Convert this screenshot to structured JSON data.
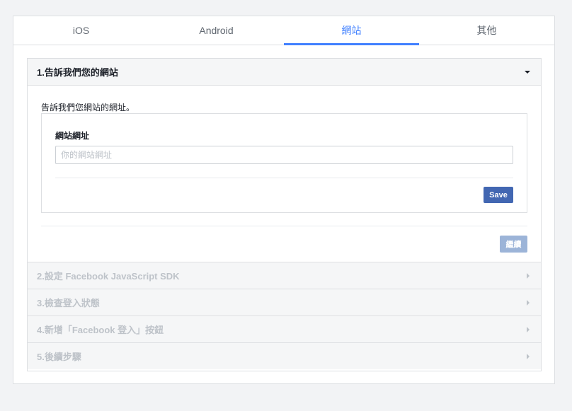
{
  "tabs": [
    {
      "label": "iOS",
      "active": false
    },
    {
      "label": "Android",
      "active": false
    },
    {
      "label": "網站",
      "active": true
    },
    {
      "label": "其他",
      "active": false
    }
  ],
  "step1": {
    "title": "1.告訴我們您的網站",
    "intro": "告訴我們您網站的網址。",
    "field_label": "網站網址",
    "placeholder": "你的網站網址",
    "save_label": "Save",
    "continue_label": "繼續"
  },
  "steps": [
    {
      "label": "2.設定 Facebook JavaScript SDK"
    },
    {
      "label": "3.檢查登入狀態"
    },
    {
      "label": "4.新增「Facebook 登入」按鈕"
    },
    {
      "label": "5.後續步驟"
    }
  ],
  "colors": {
    "accent": "#4080ff",
    "button": "#4267b2",
    "button_disabled": "#9cb4d8"
  }
}
